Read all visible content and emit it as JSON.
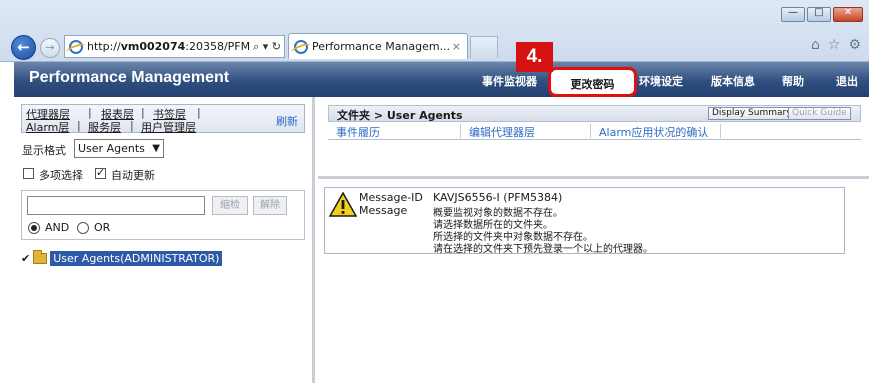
{
  "browser": {
    "address": "http://vm002074:20358/PFM",
    "address_host": "vm002074",
    "address_tools": "⌕ ▾ ↻",
    "tab_title": "Performance Managem...",
    "tab_close": "×",
    "controls": {
      "minimize": "—",
      "maximize": "□",
      "close": "✕"
    },
    "icons": {
      "home": "⌂",
      "favorites": "☆",
      "settings": "⚙"
    }
  },
  "header": {
    "title": "Performance Management",
    "nav": [
      "事件监视器",
      "更改密码",
      "环境设定",
      "版本信息",
      "帮助",
      "退出"
    ],
    "callout_number": "4."
  },
  "left": {
    "layers": [
      "代理器层",
      "报表层",
      "书签层",
      "Alarm层",
      "服务层",
      "用户管理层"
    ],
    "separator": "|",
    "refresh": "刷新",
    "display_format_label": "显示格式",
    "display_format_value": "User Agents",
    "multi_select_label": "多项选择",
    "multi_select_checked": false,
    "auto_update_label": "自动更新",
    "auto_update_checked": true,
    "filter_value": "",
    "filter_button": "缩检",
    "clear_button": "解除",
    "and_label": "AND",
    "or_label": "OR",
    "and_selected": true,
    "tree_check": "✔",
    "tree_item": "User Agents(ADMINISTRATOR)"
  },
  "right": {
    "breadcrumb": "文件夹 > User Agents",
    "display_summary": "Display Summary",
    "quick_guide": "Quick Guide",
    "tabs": [
      "事件履历",
      "编辑代理器层",
      "Alarm应用状况的确认"
    ]
  },
  "message": {
    "id_label": "Message-ID",
    "id_value": "KAVJS6556-I (PFM5384)",
    "message_label": "Message",
    "lines": [
      "概要监视对象的数据不存在。",
      "请选择数据所在的文件夹。",
      "所选择的文件夹中对象数据不存在。",
      "请在选择的文件夹下预先登录一个以上的代理器。"
    ]
  },
  "colors": {
    "header_dark": "#24416f",
    "accent_red": "#d61111",
    "link_blue": "#2d6ac4",
    "selected_blue": "#2c5aa8",
    "warning_yellow": "#f2cf1d"
  }
}
